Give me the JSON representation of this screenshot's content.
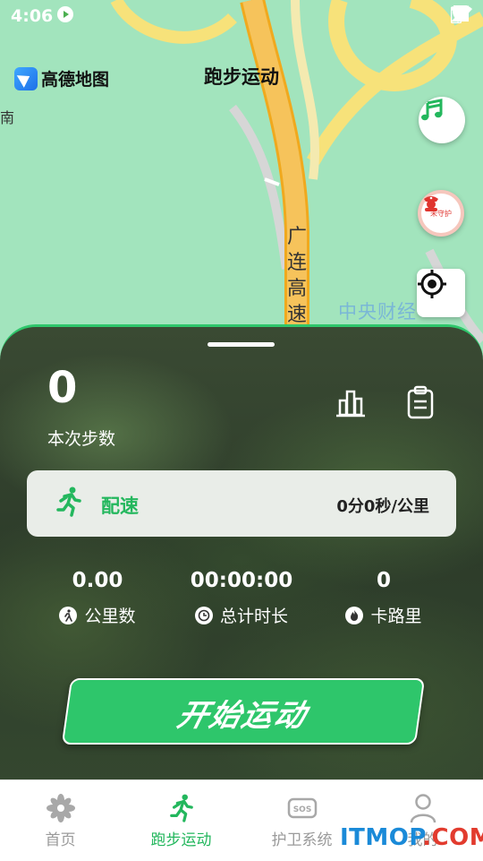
{
  "status_bar": {
    "time": "4:06"
  },
  "map": {
    "provider_logo": "高德地图",
    "page_title": "跑步运动",
    "road_label": "广连高速",
    "district_label": "中央财经",
    "edge_label": "南",
    "buttons": {
      "music": "music-icon",
      "guard": "未守护",
      "locate": "locate-icon"
    }
  },
  "panel": {
    "step_count": "0",
    "step_label": "本次步数",
    "pace": {
      "label": "配速",
      "value": "0分0秒/公里"
    },
    "stats": [
      {
        "value": "0.00",
        "label": "公里数",
        "icon": "walk-icon"
      },
      {
        "value": "00:00:00",
        "label": "总计时长",
        "icon": "clock-icon"
      },
      {
        "value": "0",
        "label": "卡路里",
        "icon": "flame-icon"
      }
    ],
    "start_button": "开始运动"
  },
  "tabbar": {
    "tabs": [
      {
        "label": "首页",
        "icon": "pinwheel-icon",
        "active": false
      },
      {
        "label": "跑步运动",
        "icon": "runner-icon",
        "active": true
      },
      {
        "label": "护卫系统",
        "icon": "sos-icon",
        "active": false
      },
      {
        "label": "我的",
        "icon": "person-icon",
        "active": false
      }
    ]
  },
  "watermark": {
    "text": "ITMOP",
    "suffix": ".COM"
  },
  "colors": {
    "accent": "#2ec66b",
    "accent_text": "#23b75d",
    "map_green": "#a2e4bd",
    "road": "#f6c35b"
  }
}
